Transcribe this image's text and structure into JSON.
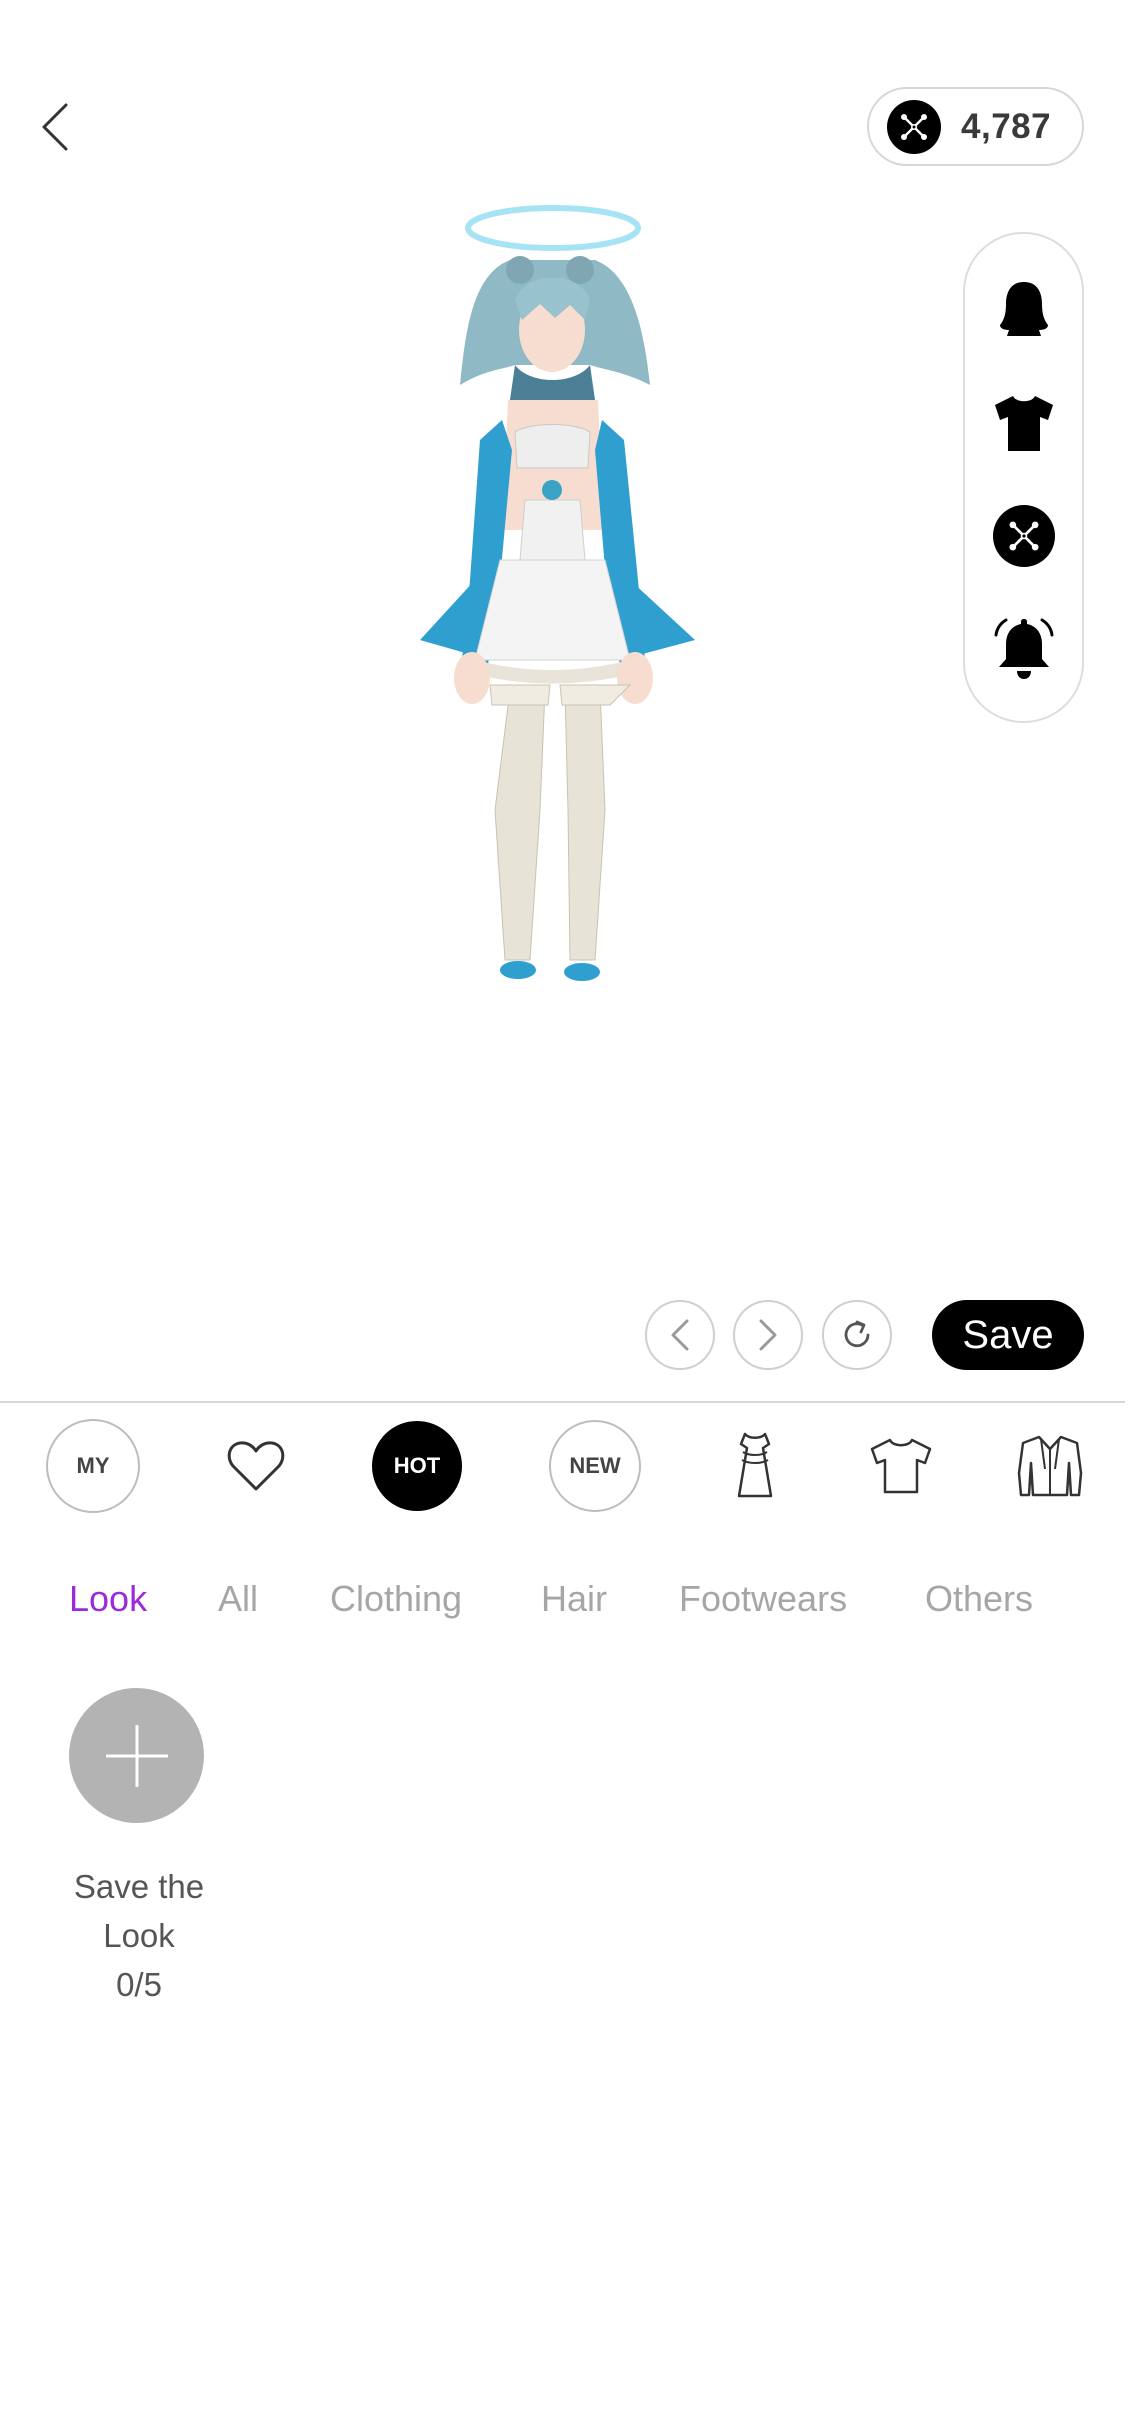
{
  "header": {
    "back_icon": "chevron-left-icon",
    "currency": {
      "icon": "cross-coin-icon",
      "value": "4,787"
    }
  },
  "side_panel": {
    "items": [
      {
        "icon": "hair-silhouette-icon"
      },
      {
        "icon": "tshirt-filled-icon"
      },
      {
        "icon": "cross-coin-icon"
      },
      {
        "icon": "bell-icon"
      }
    ]
  },
  "actions": {
    "prev_icon": "chevron-left-icon",
    "next_icon": "chevron-right-icon",
    "refresh_icon": "refresh-icon",
    "save_label": "Save"
  },
  "categories": {
    "my_label": "MY",
    "favorite_icon": "heart-outline-icon",
    "hot_label": "HOT",
    "new_label": "NEW",
    "dress_icon": "dress-icon",
    "tshirt_icon": "tshirt-outline-icon",
    "coat_icon": "coat-icon"
  },
  "tabs": [
    {
      "label": "Look",
      "active": true
    },
    {
      "label": "All",
      "active": false
    },
    {
      "label": "Clothing",
      "active": false
    },
    {
      "label": "Hair",
      "active": false
    },
    {
      "label": "Footwears",
      "active": false
    },
    {
      "label": "Others",
      "active": false
    }
  ],
  "save_look": {
    "icon": "plus-icon",
    "line1": "Save the",
    "line2": "Look",
    "count": "0/5"
  },
  "colors": {
    "accent": "#9b2ad8",
    "tab_inactive": "#a6a6a6",
    "primary_button": "#000000",
    "save_look_circle": "#b3b3b3"
  }
}
